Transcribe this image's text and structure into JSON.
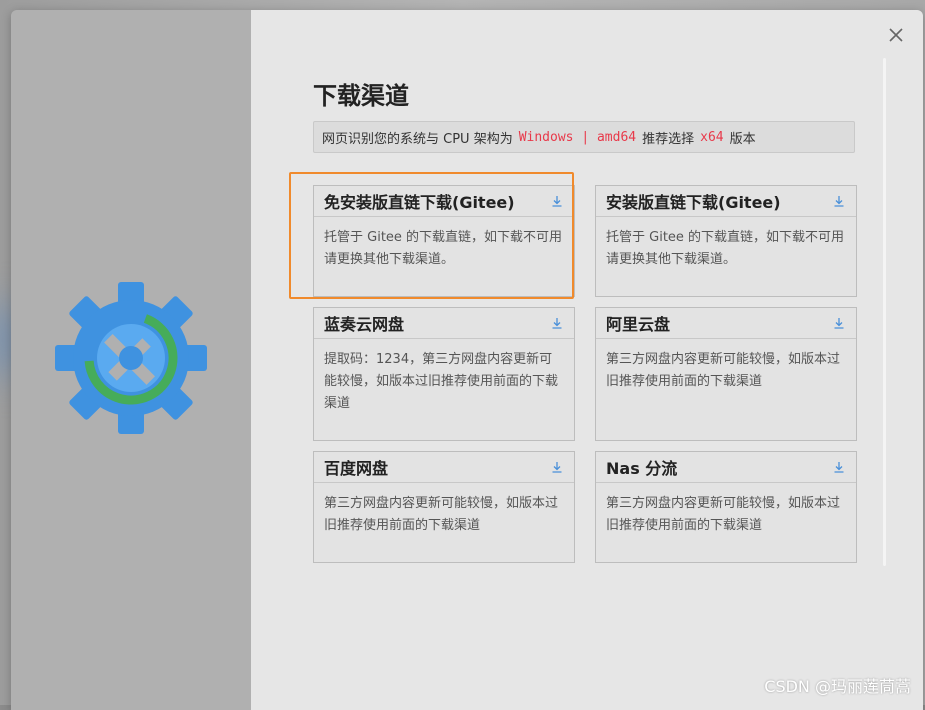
{
  "dialog": {
    "title": "下载渠道",
    "info": {
      "prefix": "网页识别您的系统与 CPU 架构为",
      "system": "Windows | amd64",
      "middle": "推荐选择",
      "arch": "x64",
      "suffix": "版本"
    },
    "close_icon": "close-icon"
  },
  "cards": [
    {
      "title": "免安装版直链下载(Gitee)",
      "desc": "托管于 Gitee 的下载直链，如下载不可用请更换其他下载渠道。",
      "icon": "download-icon"
    },
    {
      "title": "安装版直链下载(Gitee)",
      "desc": "托管于 Gitee 的下载直链，如下载不可用请更换其他下载渠道。",
      "icon": "download-icon"
    },
    {
      "title": "蓝奏云网盘",
      "desc": "提取码：1234，第三方网盘内容更新可能较慢，如版本过旧推荐使用前面的下载渠道",
      "icon": "download-icon"
    },
    {
      "title": "阿里云盘",
      "desc": "第三方网盘内容更新可能较慢，如版本过旧推荐使用前面的下载渠道",
      "icon": "download-icon"
    },
    {
      "title": "百度网盘",
      "desc": "第三方网盘内容更新可能较慢，如版本过旧推荐使用前面的下载渠道",
      "icon": "download-icon"
    },
    {
      "title": "Nas 分流",
      "desc": "第三方网盘内容更新可能较慢，如版本过旧推荐使用前面的下载渠道",
      "icon": "download-icon"
    }
  ],
  "watermark": "CSDN @玛丽莲茼蒿",
  "colors": {
    "accent_highlight": "#e8394a",
    "selection_border": "#f08a2c",
    "download_icon": "#4a90d9"
  }
}
